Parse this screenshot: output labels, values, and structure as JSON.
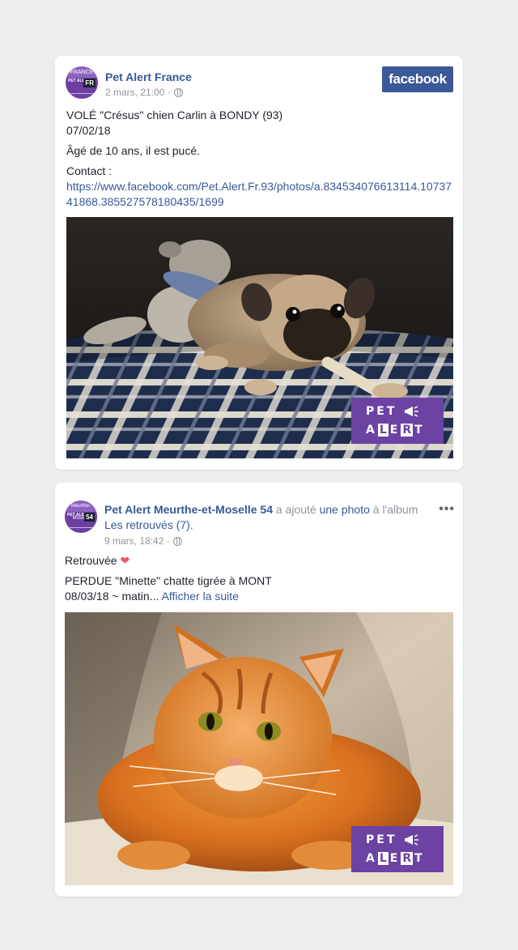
{
  "post1": {
    "avatar": {
      "top_text": "FRANCE",
      "mid_text": "PET ALERT",
      "code": "FR"
    },
    "page_name": "Pet Alert France",
    "timestamp": "2 mars, 21:00 ·",
    "badge": "facebook",
    "lines": {
      "l1": "VOLÉ \"Crésus\" chien Carlin à BONDY (93)",
      "l2": "07/02/18",
      "l3": "Âgé de 10 ans, il est pucé.",
      "l4": "Contact :",
      "link": "https://www.facebook.com/Pet.Alert.Fr.93/photos/a.834534076613114.1073741868.385527578180435/1699"
    },
    "image_icon": "pug-photo",
    "logo": {
      "word1": "PET",
      "word2_a": "A",
      "word2_b": "L",
      "word2_c": "E",
      "word2_d": "R",
      "word2_e": "T"
    }
  },
  "post2": {
    "avatar": {
      "top_text": "Meurthe-Moselle",
      "mid_text": "PET ALERT",
      "code": "54"
    },
    "page_name": "Pet Alert Meurthe-et-Moselle 54",
    "action_text": "a ajouté",
    "action_link": "une photo",
    "action_text2": "à l'album",
    "album_name": "Les retrouvés (7).",
    "timestamp": "9 mars, 18:42 ·",
    "more_label": "•••",
    "lines": {
      "status": "Retrouvée",
      "heart": "❤",
      "l1": "PERDUE \"Minette\" chatte tigrée à MONT",
      "l2": "08/03/18 ~ matin...",
      "see_more": "Afficher la suite"
    },
    "image_icon": "cat-photo",
    "logo": {
      "word1": "PET",
      "word2_a": "A",
      "word2_b": "L",
      "word2_c": "E",
      "word2_d": "R",
      "word2_e": "T"
    }
  },
  "colors": {
    "background": "#ededee",
    "link": "#385898",
    "facebook_blue": "#3b5998",
    "pet_alert_purple": "#6c42a2",
    "muted": "#90949c"
  }
}
